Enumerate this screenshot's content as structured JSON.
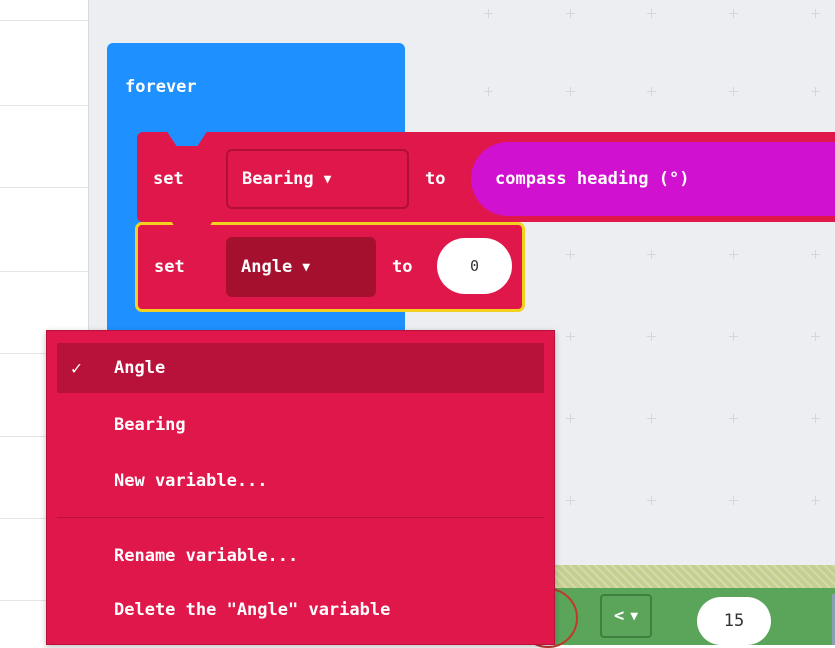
{
  "workspace": {
    "forever_label": "forever"
  },
  "set_bearing": {
    "set_label": "set",
    "variable": "Bearing",
    "to_label": "to",
    "value_block": "compass heading (°)"
  },
  "set_angle": {
    "set_label": "set",
    "variable": "Angle",
    "to_label": "to",
    "value": "0"
  },
  "dropdown_menu": {
    "items": [
      {
        "label": "Angle",
        "checked": true
      },
      {
        "label": "Bearing",
        "checked": false
      },
      {
        "label": "New variable...",
        "checked": false
      },
      {
        "label": "Rename variable...",
        "checked": false
      },
      {
        "label": "Delete the \"Angle\" variable",
        "checked": false
      }
    ],
    "check_glyph": "✓"
  },
  "background_blocks": {
    "compare_caret": "<",
    "number_value": "15"
  },
  "colors": {
    "variables_block": "#e0174a",
    "loops_block": "#1e90ff",
    "input_block": "#d011d0",
    "selection_outline": "#f2d21e",
    "logic_block": "#5ba55b"
  },
  "icons": [
    "chevron-down-icon",
    "checkmark-icon"
  ]
}
